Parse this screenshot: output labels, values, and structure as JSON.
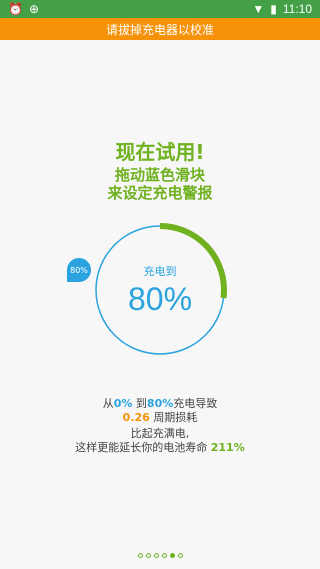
{
  "status_bar": {
    "time": "11:10",
    "icons": [
      "alarm-icon",
      "notification-icon",
      "wifi-icon",
      "battery-icon"
    ]
  },
  "banner": {
    "text": "请拔掉充电器以校准"
  },
  "title": "现在试用!",
  "subtitle_line1": "拖动蓝色滑块",
  "subtitle_line2": "来设定充电警报",
  "dial": {
    "label": "充电到",
    "value": "80%",
    "bubble": "80%",
    "progress": 0.27
  },
  "info": {
    "from_prefix": "从",
    "from_value": "0%",
    "to_prefix": "到",
    "to_value": "80%",
    "cause_suffix": "充电导致",
    "cycle_value": "0.26",
    "cycle_suffix": "周期损耗",
    "compare_line": "比起充满电,",
    "extend_text": "这样更能延长你的电池寿命",
    "extend_value": "211%"
  },
  "pager": {
    "count": 6,
    "active_index": 4
  },
  "colors": {
    "green": "#6fb11f",
    "blue": "#2aa3df",
    "orange": "#f5920a",
    "status_green": "#43a047"
  }
}
